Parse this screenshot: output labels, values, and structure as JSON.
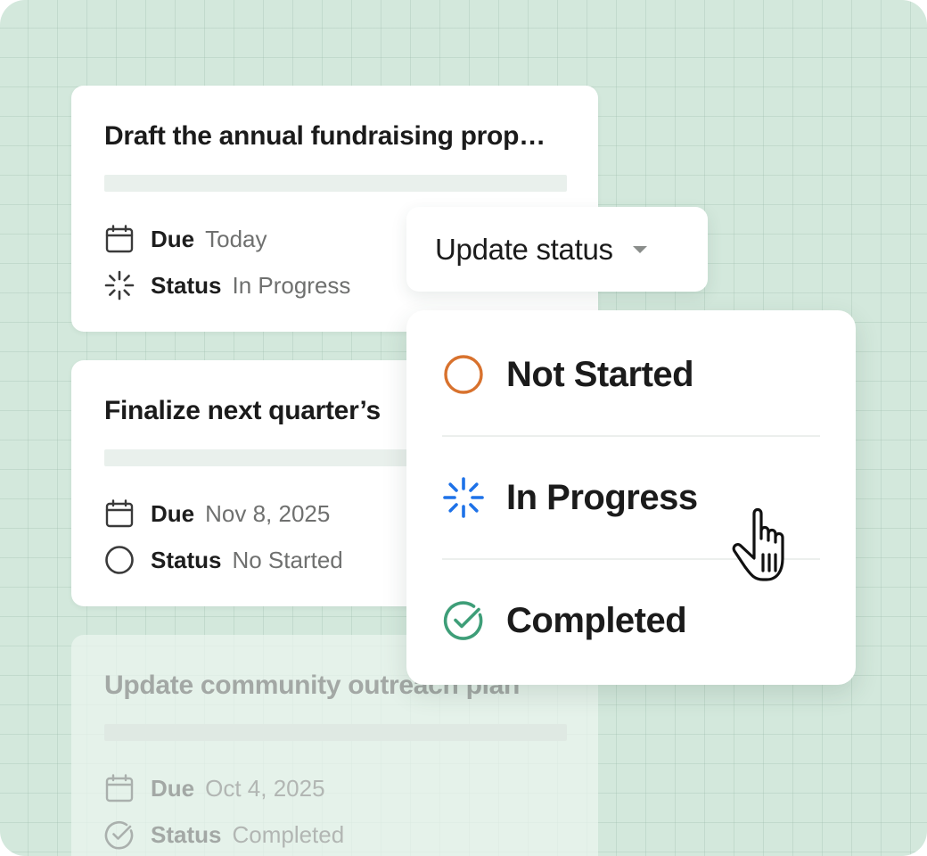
{
  "cards": [
    {
      "title": "Draft the annual fundraising prop…",
      "due_label": "Due",
      "due_value": "Today",
      "status_label": "Status",
      "status_value": "In Progress",
      "status_icon": "in-progress-icon"
    },
    {
      "title": "Finalize next quarter’s",
      "due_label": "Due",
      "due_value": "Nov 8, 2025",
      "status_label": "Status",
      "status_value": "No Started",
      "status_icon": "not-started-icon"
    },
    {
      "title": "Update community outreach plan",
      "due_label": "Due",
      "due_value": "Oct 4, 2025",
      "status_label": "Status",
      "status_value": "Completed",
      "status_icon": "completed-icon"
    }
  ],
  "status_button": {
    "label": "Update status",
    "icon": "caret-down-icon"
  },
  "status_menu": {
    "items": [
      {
        "label": "Not Started",
        "icon": "not-started-icon",
        "color": "#D8722E"
      },
      {
        "label": "In Progress",
        "icon": "in-progress-icon",
        "color": "#1E72E8"
      },
      {
        "label": "Completed",
        "icon": "completed-icon",
        "color": "#3E9E78"
      }
    ]
  },
  "colors": {
    "background": "#D3E8DC",
    "card": "#FFFFFF",
    "text_primary": "#1B1B1B",
    "text_secondary": "#6F706F"
  }
}
